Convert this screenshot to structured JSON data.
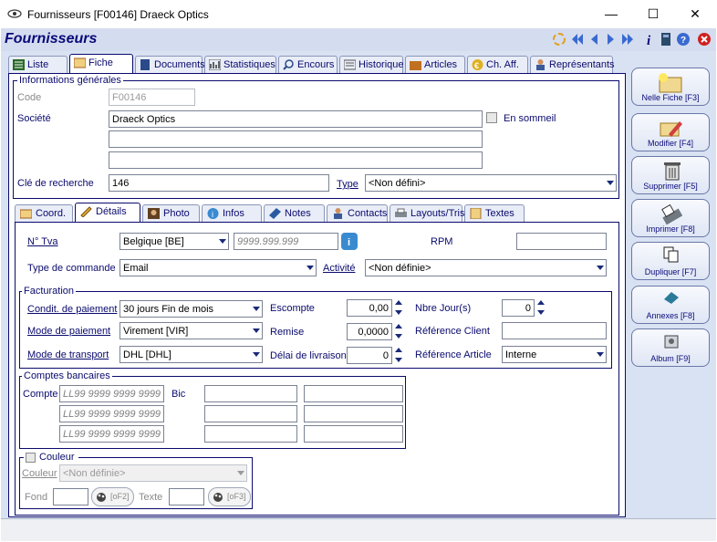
{
  "window": {
    "title": "Fournisseurs  [F00146] Draeck Optics"
  },
  "header": {
    "title": "Fournisseurs"
  },
  "tabs": [
    "Liste",
    "Fiche",
    "Documents",
    "Statistiques",
    "Encours",
    "Historique",
    "Articles",
    "Ch. Aff.",
    "Représentants"
  ],
  "general": {
    "legend": "Informations générales",
    "code_label": "Code",
    "code_value": "F00146",
    "societe_label": "Société",
    "societe_value": "Draeck Optics",
    "sommeil_label": "En sommeil",
    "cle_label": "Clé de recherche",
    "cle_value": "146",
    "type_label": "Type",
    "type_value": "<Non défini>"
  },
  "subtabs": [
    "Coord.",
    "Détails",
    "Photo",
    "Infos",
    "Notes",
    "Contacts",
    "Layouts/Tris",
    "Textes"
  ],
  "details": {
    "tva_label": "N° Tva",
    "tva_country": "Belgique [BE]",
    "tva_placeholder": "9999.999.999",
    "rpm_label": "RPM",
    "cmd_label": "Type de commande",
    "cmd_value": "Email",
    "activite_label": "Activité",
    "activite_value": "<Non définie>"
  },
  "facturation": {
    "legend": "Facturation",
    "condit_label": "Condit. de paiement",
    "condit_value": "30 jours Fin de mois",
    "mode_pay_label": "Mode de paiement",
    "mode_pay_value": "Virement [VIR]",
    "mode_tr_label": "Mode de transport",
    "mode_tr_value": "DHL [DHL]",
    "escompte_label": "Escompte",
    "escompte_value": "0,00",
    "remise_label": "Remise",
    "remise_value": "0,0000",
    "delai_label": "Délai de livraison",
    "delai_value": "0",
    "jours_label": "Nbre Jour(s)",
    "jours_value": "0",
    "ref_client_label": "Référence Client",
    "ref_article_label": "Référence Article",
    "ref_article_value": "Interne"
  },
  "comptes": {
    "legend": "Comptes bancaires",
    "compte_label": "Compte",
    "bic_label": "Bic",
    "iban_placeholder": "LL99 9999 9999 9999"
  },
  "couleur": {
    "legend": "Couleur",
    "couleur_label": "Couleur",
    "couleur_value": "<Non définie>",
    "fond_label": "Fond",
    "fond_btn": "[oF2]",
    "texte_label": "Texte",
    "texte_btn": "[oF3]"
  },
  "sidebar": {
    "new": "Nelle Fiche [F3]",
    "modify": "Modifier [F4]",
    "delete": "Supprimer [F5]",
    "print": "Imprimer [F8]",
    "duplicate": "Dupliquer [F7]",
    "annexes": "Annexes [F8]",
    "album": "Album [F9]"
  },
  "colors": {
    "accent": "#0a0a6e",
    "header_bg": "#d4dcef",
    "body_bg": "#d9e2f3"
  }
}
